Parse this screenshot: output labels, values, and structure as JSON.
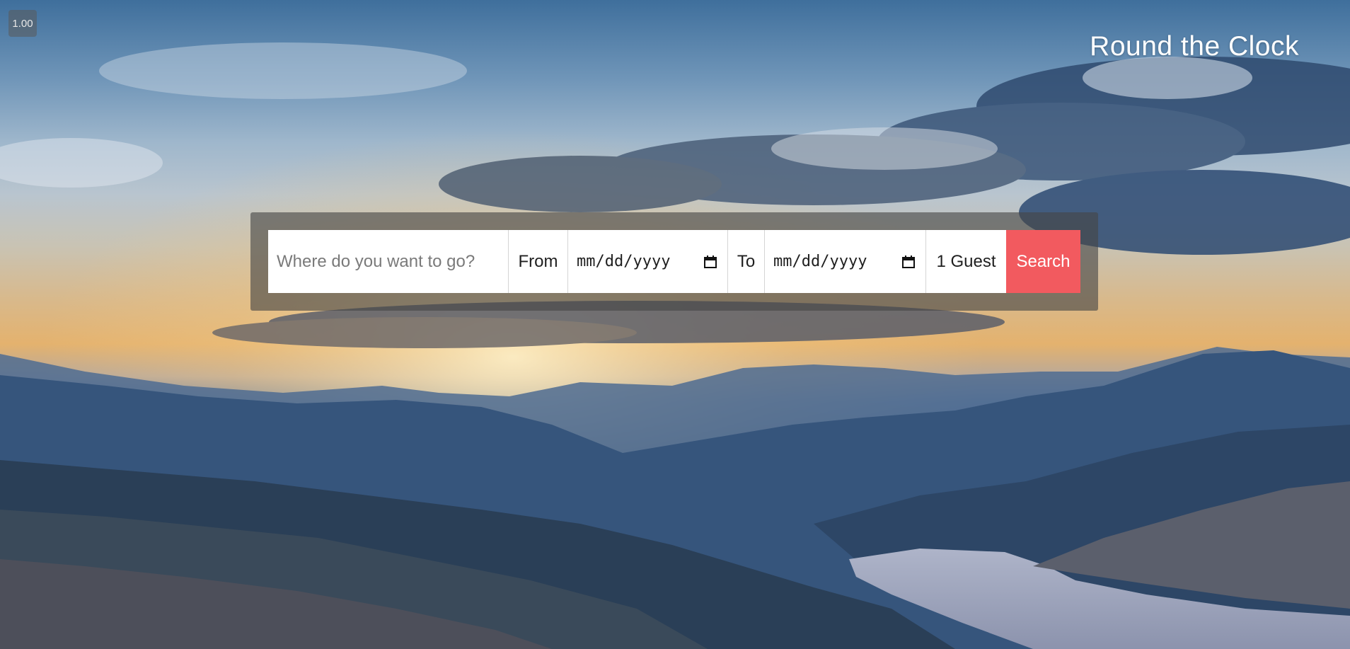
{
  "zoom_level": "1.00",
  "brand": {
    "title": "Round the Clock"
  },
  "search": {
    "destination_placeholder": "Where do you want to go?",
    "destination_value": "",
    "from_label": "From",
    "from_date_display": "mm/dd/yyyy",
    "to_label": "To",
    "to_date_display": "mm/dd/yyyy",
    "guests_label": "1 Guest",
    "search_button_label": "Search",
    "calendar_icon": "calendar-icon"
  },
  "colors": {
    "search_button": "#f25a5f",
    "panel_backdrop": "rgba(70,70,70,0.62)",
    "brand_text": "#ffffff"
  }
}
